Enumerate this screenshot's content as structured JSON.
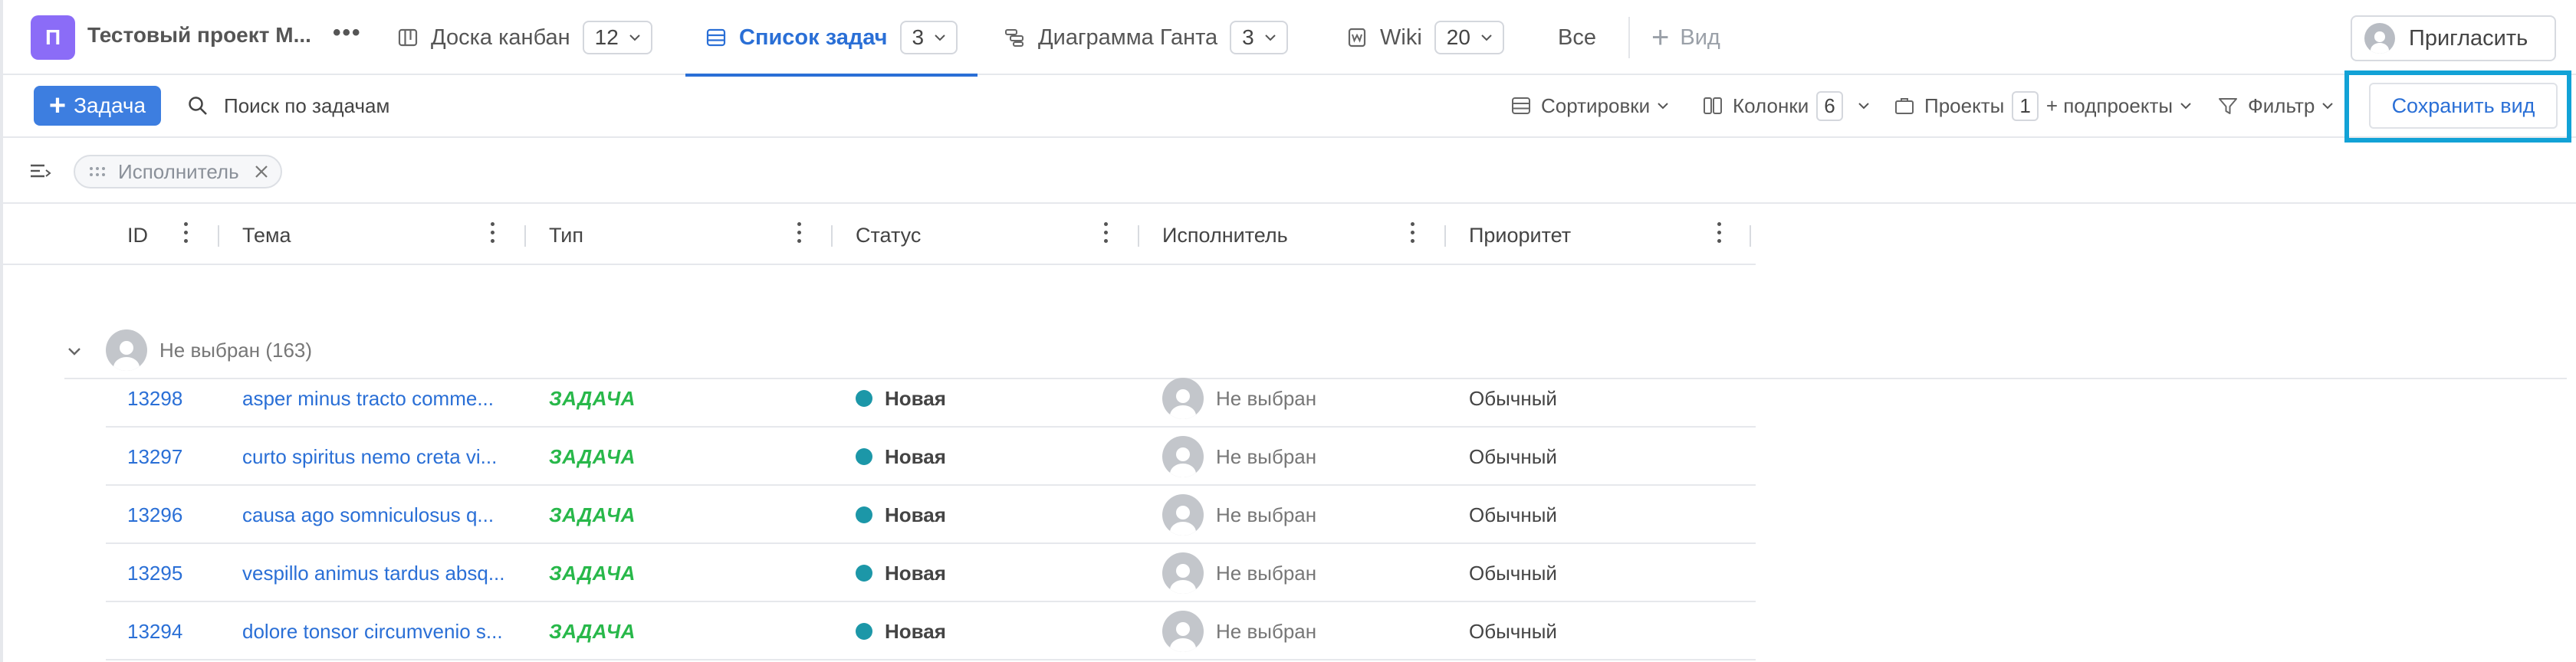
{
  "project": {
    "avatar_letter": "П",
    "name": "Тестовый проект М...",
    "more": "•••"
  },
  "nav": {
    "tabs": [
      {
        "label": "Доска канбан",
        "count": "12",
        "icon": "kanban-icon",
        "active": false
      },
      {
        "label": "Список задач",
        "count": "3",
        "icon": "list-icon",
        "active": true
      },
      {
        "label": "Диаграмма Ганта",
        "count": "3",
        "icon": "gantt-icon",
        "active": false
      },
      {
        "label": "Wiki",
        "count": "20",
        "icon": "wiki-icon",
        "active": false
      }
    ],
    "all_label": "Все",
    "add_view_label": "Вид",
    "invite_label": "Пригласить"
  },
  "toolbar": {
    "add_task_label": "Задача",
    "search_placeholder": "Поиск по задачам",
    "sort_label": "Сортировки",
    "columns_label": "Колонки",
    "columns_count": "6",
    "projects_label": "Проекты",
    "projects_count": "1",
    "subprojects_label": "+ подпроекты",
    "filter_label": "Фильтр",
    "save_view_label": "Сохранить вид"
  },
  "grouping": {
    "chip_label": "Исполнитель"
  },
  "table": {
    "columns": [
      "ID",
      "Тема",
      "Тип",
      "Статус",
      "Исполнитель",
      "Приоритет"
    ],
    "group": {
      "label": "Не выбран (163)"
    },
    "rows": [
      {
        "id": "13298",
        "topic": "asper minus tracto comme...",
        "type": "ЗАДАЧА",
        "status": "Новая",
        "assignee": "Не выбран",
        "priority": "Обычный"
      },
      {
        "id": "13297",
        "topic": "curto spiritus nemo creta vi...",
        "type": "ЗАДАЧА",
        "status": "Новая",
        "assignee": "Не выбран",
        "priority": "Обычный"
      },
      {
        "id": "13296",
        "topic": "causa ago somniculosus q...",
        "type": "ЗАДАЧА",
        "status": "Новая",
        "assignee": "Не выбран",
        "priority": "Обычный"
      },
      {
        "id": "13295",
        "topic": "vespillo animus tardus absq...",
        "type": "ЗАДАЧА",
        "status": "Новая",
        "assignee": "Не выбран",
        "priority": "Обычный"
      },
      {
        "id": "13294",
        "topic": "dolore tonsor circumvenio s...",
        "type": "ЗАДАЧА",
        "status": "Новая",
        "assignee": "Не выбран",
        "priority": "Обычный"
      }
    ]
  },
  "colors": {
    "accent": "#2a6fd6",
    "primary_button": "#3d7ee0",
    "type_green": "#28b84a",
    "status_teal": "#1c97a8",
    "highlight_frame": "#12a2d6"
  }
}
